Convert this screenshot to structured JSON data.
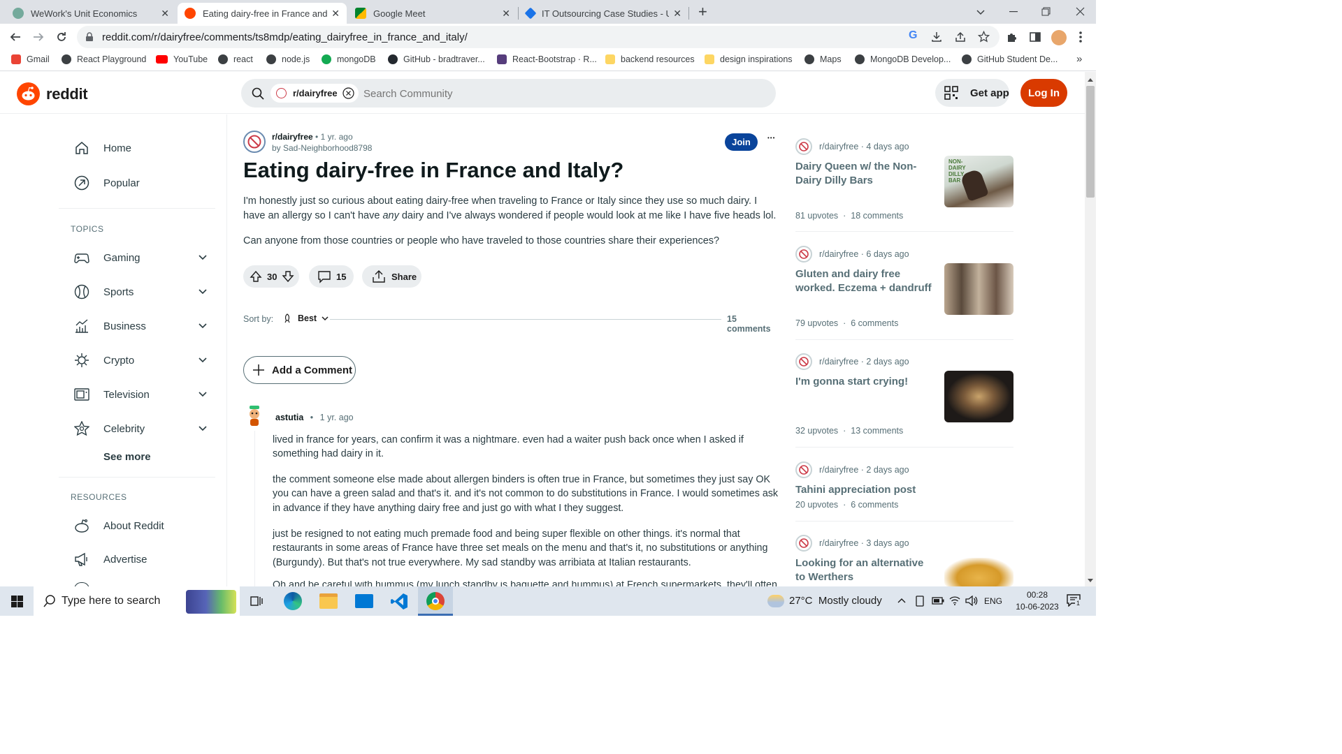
{
  "browser": {
    "tabs": [
      {
        "title": "WeWork's Unit Economics",
        "close": "✕"
      },
      {
        "title": "Eating dairy-free in France and It",
        "close": "✕"
      },
      {
        "title": "Google Meet",
        "close": "✕"
      },
      {
        "title": "IT Outsourcing Case Studies - US",
        "close": "✕"
      }
    ],
    "new_tab": "+",
    "url": "reddit.com/r/dairyfree/comments/ts8mdp/eating_dairyfree_in_france_and_italy/",
    "bookmarks": [
      {
        "label": "Gmail",
        "color": "#ea4335"
      },
      {
        "label": "React Playground",
        "color": "#3c4043"
      },
      {
        "label": "YouTube",
        "color": "#ff0000"
      },
      {
        "label": "react",
        "color": "#3c4043"
      },
      {
        "label": "node.js",
        "color": "#3c4043"
      },
      {
        "label": "mongoDB",
        "color": "#13aa52"
      },
      {
        "label": "GitHub - bradtraver...",
        "color": "#24292f"
      },
      {
        "label": "React-Bootstrap · R...",
        "color": "#563d7c"
      },
      {
        "label": "backend resources",
        "color": "#fdd663"
      },
      {
        "label": "design inspirations",
        "color": "#fdd663"
      },
      {
        "label": "Maps",
        "color": "#3c4043"
      },
      {
        "label": "MongoDB Develop...",
        "color": "#3c4043"
      },
      {
        "label": "GitHub Student De...",
        "color": "#3c4043"
      }
    ],
    "more": "»"
  },
  "reddit": {
    "logo_text": "reddit",
    "brand_color": "#ff4500",
    "search_chip": "r/dairyfree",
    "search_placeholder": "Search Community",
    "get_app": "Get app",
    "login": "Log In"
  },
  "leftnav": {
    "home": "Home",
    "popular": "Popular",
    "topics_label": "TOPICS",
    "topics": [
      "Gaming",
      "Sports",
      "Business",
      "Crypto",
      "Television",
      "Celebrity"
    ],
    "see_more": "See more",
    "resources_label": "RESOURCES",
    "resources": [
      "About Reddit",
      "Advertise"
    ]
  },
  "post": {
    "subreddit": "r/dairyfree",
    "dot": "•",
    "age": "1 yr. ago",
    "author": "by Sad-Neighborhood8798",
    "join": "Join",
    "more": "•••",
    "title": "Eating dairy-free in France and Italy?",
    "body_p1_a": "I'm honestly just so curious about eating dairy-free when traveling to France or Italy since they use so much dairy. I have an allergy so I can't have ",
    "body_p1_em": "any",
    "body_p1_b": " dairy and I've always wondered if people would look at me like I have five heads lol.",
    "body_p2": "Can anyone from those countries or people who have traveled to those countries share their experiences?",
    "votes": "30",
    "comments_count": "15",
    "share": "Share",
    "sort_label": "Sort by:",
    "sort_value": "Best",
    "comments_total": "15 comments",
    "add_comment": "Add a Comment"
  },
  "comment": {
    "author": "astutia",
    "dot": "•",
    "age": "1 yr. ago",
    "p1": "lived in france for years, can confirm it was a nightmare. even had a waiter push back once when I asked if something had dairy in it.",
    "p2": "the comment someone else made about allergen binders is often true in France, but sometimes they just say OK you can have a green salad and that's it. and it's not common to do substitutions in France. I would sometimes ask in advance if they have anything dairy free and just go with what I they suggest.",
    "p3": "just be resigned to not eating much premade food and being super flexible on other things. it's normal that restaurants in some areas of France have three set meals on the menu and that's it, no substitutions or anything (Burgundy). But that's not true everywhere. My sad standby was arribiata at Italian restaurants.",
    "p4": "Oh and be careful with hummus (my lunch standby is baguette and hummus) at French supermarkets, they'll often"
  },
  "related": [
    {
      "sub": "r/dairyfree",
      "age": "· 4 days ago",
      "title": "Dairy Queen w/ the Non-Dairy Dilly Bars",
      "upvotes": "81 upvotes",
      "sep": "·",
      "comments": "18 comments"
    },
    {
      "sub": "r/dairyfree",
      "age": "· 6 days ago",
      "title": "Gluten and dairy free worked. Eczema + dandruff",
      "upvotes": "79 upvotes",
      "sep": "·",
      "comments": "6 comments"
    },
    {
      "sub": "r/dairyfree",
      "age": "· 2 days ago",
      "title": "I'm gonna start crying!",
      "upvotes": "32 upvotes",
      "sep": "·",
      "comments": "13 comments"
    },
    {
      "sub": "r/dairyfree",
      "age": "· 2 days ago",
      "title": "Tahini appreciation post",
      "upvotes": "20 upvotes",
      "sep": "·",
      "comments": "6 comments"
    },
    {
      "sub": "r/dairyfree",
      "age": "· 3 days ago",
      "title": "Looking for an alternative to Werthers",
      "upvotes": "",
      "sep": "",
      "comments": ""
    }
  ],
  "thumb_text": {
    "dilly": "NON-DAIRY DILLY BAR"
  },
  "taskbar": {
    "search_placeholder": "Type here to search",
    "weather": "27°C  Mostly cloudy",
    "lang": "ENG",
    "time": "00:28",
    "date": "10-06-2023",
    "notifications": "1"
  }
}
